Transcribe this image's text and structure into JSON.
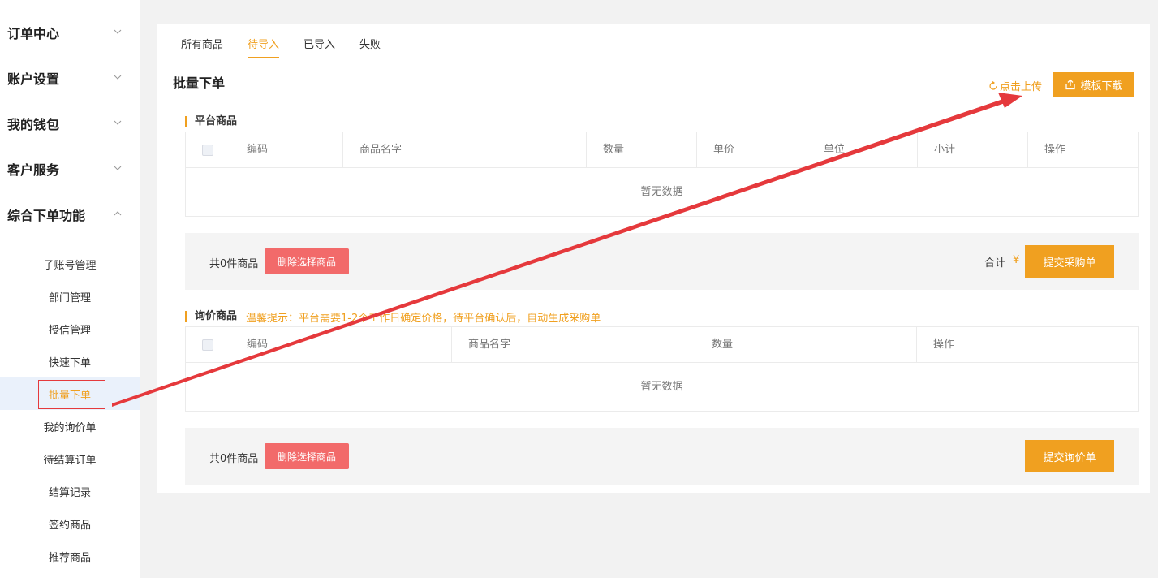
{
  "sidebar": {
    "groups": [
      {
        "label": "订单中心",
        "expanded": false
      },
      {
        "label": "账户设置",
        "expanded": false
      },
      {
        "label": "我的钱包",
        "expanded": false
      },
      {
        "label": "客户服务",
        "expanded": false
      },
      {
        "label": "综合下单功能",
        "expanded": true
      }
    ],
    "sub_items": [
      {
        "label": "子账号管理"
      },
      {
        "label": "部门管理"
      },
      {
        "label": "授信管理"
      },
      {
        "label": "快速下单"
      },
      {
        "label": "批量下单",
        "active": true
      },
      {
        "label": "我的询价单"
      },
      {
        "label": "待结算订单"
      },
      {
        "label": "结算记录"
      },
      {
        "label": "签约商品"
      },
      {
        "label": "推荐商品"
      }
    ]
  },
  "tabs": [
    {
      "label": "所有商品"
    },
    {
      "label": "待导入",
      "active": true
    },
    {
      "label": "已导入"
    },
    {
      "label": "失败"
    }
  ],
  "page_title": "批量下单",
  "upload_label": "点击上传",
  "template_button": "模板下载",
  "platform": {
    "title": "平台商品",
    "columns": [
      "编码",
      "商品名字",
      "数量",
      "单价",
      "单位",
      "小计",
      "操作"
    ],
    "empty_text": "暂无数据",
    "count_text": "共0件商品",
    "delete_button": "删除选择商品",
    "total_label": "合计",
    "currency": "¥",
    "submit_button": "提交采购单"
  },
  "inquiry": {
    "title": "询价商品",
    "warning": "温馨提示：平台需要1-2个工作日确定价格，待平台确认后，自动生成采购单",
    "columns": [
      "编码",
      "商品名字",
      "数量",
      "操作"
    ],
    "empty_text": "暂无数据",
    "count_text": "共0件商品",
    "delete_button": "删除选择商品",
    "submit_button": "提交询价单"
  },
  "colors": {
    "accent": "#f0a020",
    "danger": "#f26a6a",
    "annotation": "#e5393c"
  }
}
